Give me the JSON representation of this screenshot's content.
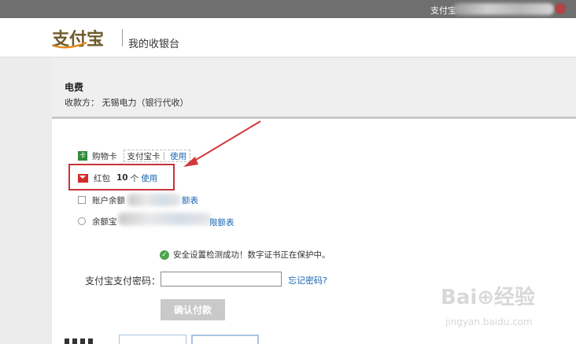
{
  "topbar": {
    "user_prefix": "支付宝"
  },
  "header": {
    "logo_text": "支付宝",
    "cashier_title": "我的收银台"
  },
  "order": {
    "title": "电费",
    "payee": "收款方： 无锡电力（银行代收）"
  },
  "payment_options": {
    "shopping_card": {
      "label": "购物卡",
      "tab_label": "支付宝卡",
      "separator": "|",
      "use_label": "使用"
    },
    "red_packet": {
      "label": "红包",
      "count": "10",
      "unit": "个",
      "use_label": "使用"
    },
    "balance": {
      "label": "账户余额",
      "limits_label": "额表"
    },
    "yuebao": {
      "label": "余额宝",
      "limits_label": "限额表"
    }
  },
  "security": {
    "message": "安全设置检测成功！数字证书正在保护中。"
  },
  "password": {
    "label": "支付宝支付密码：",
    "value": "",
    "forgot_label": "忘记密码?"
  },
  "confirm_button": "确认付款",
  "watermark": {
    "main": "Bai⊕经验",
    "sub": "jingyan.baidu.com"
  },
  "colors": {
    "accent_red": "#c8333a",
    "link": "#1a66b3",
    "success": "#4ea34e"
  }
}
